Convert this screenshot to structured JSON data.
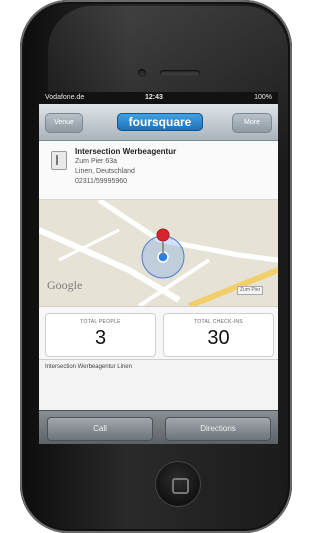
{
  "status_bar": {
    "carrier": "Vodafone.de",
    "time": "12:43",
    "battery": "100%"
  },
  "nav": {
    "back_label": "Venue",
    "logo_text": "foursquare",
    "more_label": "More"
  },
  "venue": {
    "name": "Intersection Werbeagentur",
    "address_line1": "Zum Pier 63a",
    "address_line2": "Linen, Deutschland",
    "phone": "02311/59995960"
  },
  "map": {
    "provider_logo": "Google",
    "street_label": "Zum Pier"
  },
  "stats": {
    "people_label": "TOTAL PEOPLE",
    "people_value": "3",
    "checkins_label": "TOTAL CHECK-INS",
    "checkins_value": "30"
  },
  "footer_text": "Intersection Werbeagentur Linen",
  "toolbar": {
    "call_label": "Call",
    "directions_label": "Directions"
  },
  "colors": {
    "logo_blue": "#2b87cf",
    "pin_red": "#d9242a",
    "location_blue": "#2b7fe0"
  }
}
